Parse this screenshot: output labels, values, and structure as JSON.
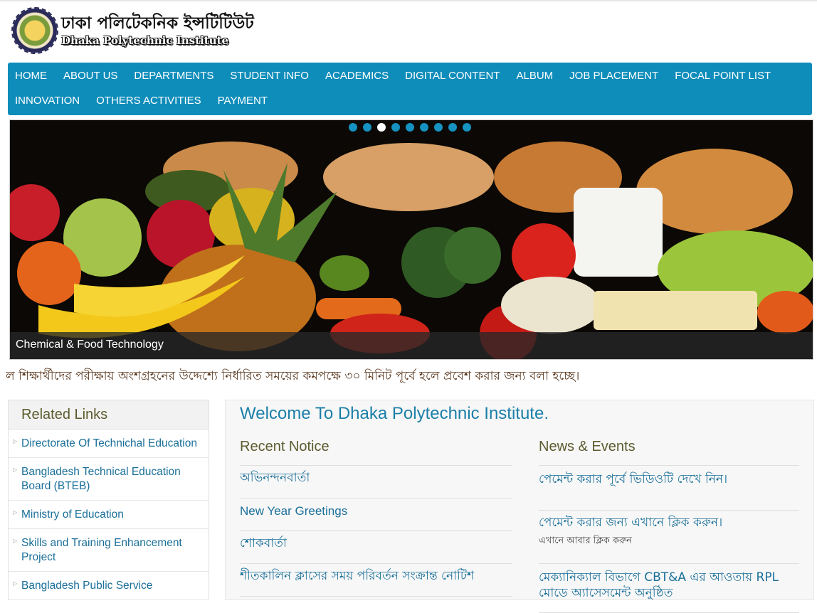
{
  "header": {
    "logo_bn": "ঢাকা পলিটেকনিক ইন্সটিটিউট",
    "logo_en": "Dhaka Polytechnic Institute"
  },
  "nav": {
    "row1": [
      "HOME",
      "ABOUT US",
      "DEPARTMENTS",
      "STUDENT INFO",
      "ACADEMICS",
      "DIGITAL CONTENT",
      "ALBUM",
      "JOB PLACEMENT",
      "FOCAL POINT LIST"
    ],
    "row2": [
      "INNOVATION",
      "OTHERS ACTIVITIES",
      "PAYMENT"
    ]
  },
  "slider": {
    "caption": "Chemical & Food Technology",
    "slide_count": 9,
    "active_index": 2
  },
  "marquee": {
    "text": "ল শিক্ষার্থীদের পরীক্ষায় অংশগ্রহনের উদ্দেশ্যে নির্ধারিত সময়ের কমপক্ষে ৩০ মিনিট পূর্বে হলে প্রবেশ করার জন্য বলা হচ্ছে।"
  },
  "related": {
    "title": "Related Links",
    "links": [
      "Directorate Of Technichal Education",
      "Bangladesh Technical Education Board (BTEB)",
      "Ministry of Education",
      "Skills and Training Enhancement Project",
      "Bangladesh Public Service"
    ]
  },
  "main": {
    "welcome": "Welcome To Dhaka Polytechnic Institute.",
    "notice_title": "Recent Notice",
    "notices": [
      "অভিনন্দনবার্তা",
      "New Year Greetings",
      "শোকবার্তা",
      "শীতকালিন ক্লাসের সময় পরিবর্তন সংক্রান্ত নোটিশ"
    ],
    "news_title": "News & Events",
    "news": [
      {
        "title": "পেমেন্ট করার পূর্বে ভিডিওটি দেখে নিন।",
        "sub": ""
      },
      {
        "title": "পেমেন্ট করার জন্য এখানে ক্লিক করুন।",
        "sub": "এখানে আবার ক্লিক করুন"
      },
      {
        "title": "মেক্যানিক্যাল বিভাগে CBT&A এর আওতায় RPL মোডে অ্যাসেসমেন্ট অনুষ্ঠিত",
        "sub": ""
      }
    ]
  },
  "colors": {
    "nav_bg": "#0f8dba",
    "link": "#1a6f99",
    "heading": "#5c5b2f",
    "marquee": "#5b3a21"
  }
}
